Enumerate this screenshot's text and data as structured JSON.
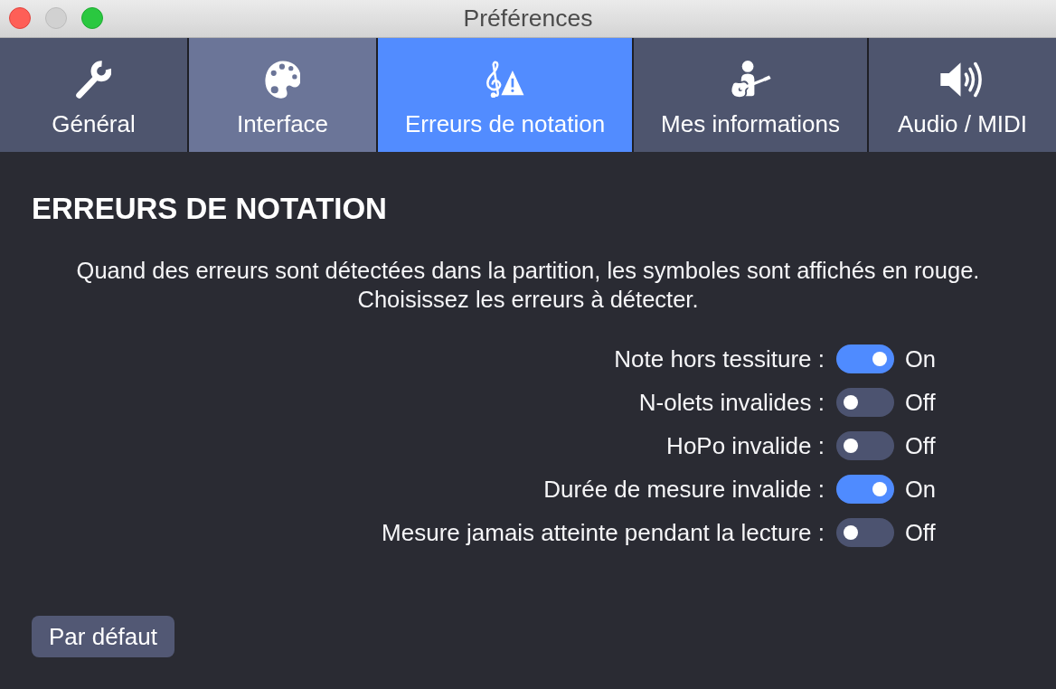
{
  "window": {
    "title": "Préférences",
    "buttons": [
      {
        "kind": "close",
        "disabled": false
      },
      {
        "kind": "minimize",
        "disabled": true
      },
      {
        "kind": "zoom",
        "disabled": false
      }
    ]
  },
  "tabs": [
    {
      "label": "Général",
      "selected": false,
      "hovered": false
    },
    {
      "label": "Interface",
      "selected": false,
      "hovered": true
    },
    {
      "label": "Erreurs de notation",
      "selected": true,
      "hovered": false
    },
    {
      "label": "Mes informations",
      "selected": false,
      "hovered": false
    },
    {
      "label": "Audio / MIDI",
      "selected": false,
      "hovered": false
    }
  ],
  "section": {
    "heading": "ERREURS DE NOTATION",
    "description_lines": [
      "Quand des erreurs sont détectées dans la partition, les symboles sont affichés en rouge.",
      "Choisissez les erreurs à détecter."
    ]
  },
  "options": [
    {
      "label": "Note hors tessiture :",
      "on": true,
      "state_text": "On"
    },
    {
      "label": "N-olets invalides :",
      "on": false,
      "state_text": "Off"
    },
    {
      "label": "HoPo invalide :",
      "on": false,
      "state_text": "Off"
    },
    {
      "label": "Durée de mesure invalide :",
      "on": true,
      "state_text": "On"
    },
    {
      "label": "Mesure jamais atteinte pendant la lecture :",
      "on": false,
      "state_text": "Off"
    }
  ],
  "footer": {
    "button": "Par défaut"
  }
}
